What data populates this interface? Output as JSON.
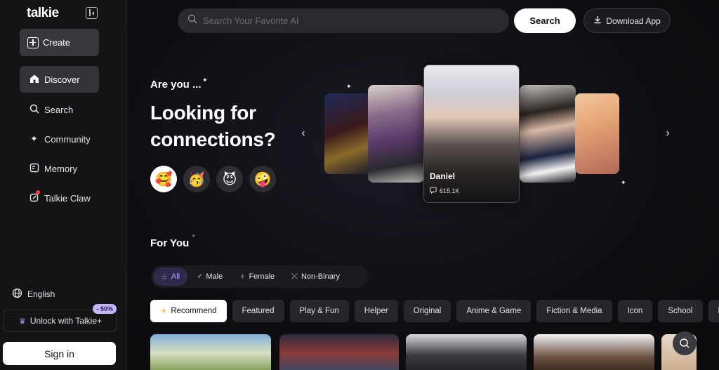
{
  "sidebar": {
    "logo": "talkie",
    "create_label": "Create",
    "nav": [
      {
        "label": "Discover",
        "icon": "home-icon",
        "active": true
      },
      {
        "label": "Search",
        "icon": "search-icon",
        "active": false
      },
      {
        "label": "Community",
        "icon": "sparkle-icon",
        "active": false
      },
      {
        "label": "Memory",
        "icon": "memory-icon",
        "active": false
      },
      {
        "label": "Talkie Claw",
        "icon": "claw-icon",
        "active": false
      }
    ],
    "language": "English",
    "unlock_label": "Unlock with Talkie+",
    "discount_badge": "- 50%",
    "signin_label": "Sign in"
  },
  "header": {
    "search_placeholder": "Search Your Favorite AI",
    "search_button": "Search",
    "download_button": "Download App"
  },
  "hero": {
    "kicker": "Are you ...",
    "headline": "Looking for connections?",
    "emojis": [
      "🥰",
      "🥳",
      "😈",
      "🤪"
    ],
    "featured_card": {
      "name": "Daniel",
      "count": "615.1K"
    }
  },
  "for_you": {
    "title": "For You",
    "gender_tabs": [
      {
        "label": "All",
        "icon": "☆",
        "active": true
      },
      {
        "label": "Male",
        "icon": "♂",
        "active": false
      },
      {
        "label": "Female",
        "icon": "♀",
        "active": false
      },
      {
        "label": "Non-Binary",
        "icon": "⤫",
        "active": false
      }
    ],
    "categories": [
      {
        "label": "Recommend",
        "active": true
      },
      {
        "label": "Featured",
        "active": false
      },
      {
        "label": "Play & Fun",
        "active": false
      },
      {
        "label": "Helper",
        "active": false
      },
      {
        "label": "Original",
        "active": false
      },
      {
        "label": "Anime & Game",
        "active": false
      },
      {
        "label": "Fiction & Media",
        "active": false
      },
      {
        "label": "Icon",
        "active": false
      },
      {
        "label": "School",
        "active": false
      },
      {
        "label": "F",
        "active": false
      }
    ]
  },
  "colors": {
    "accent": "#b9a7ff",
    "background": "#0c0c0e",
    "sidebar": "#141416"
  }
}
